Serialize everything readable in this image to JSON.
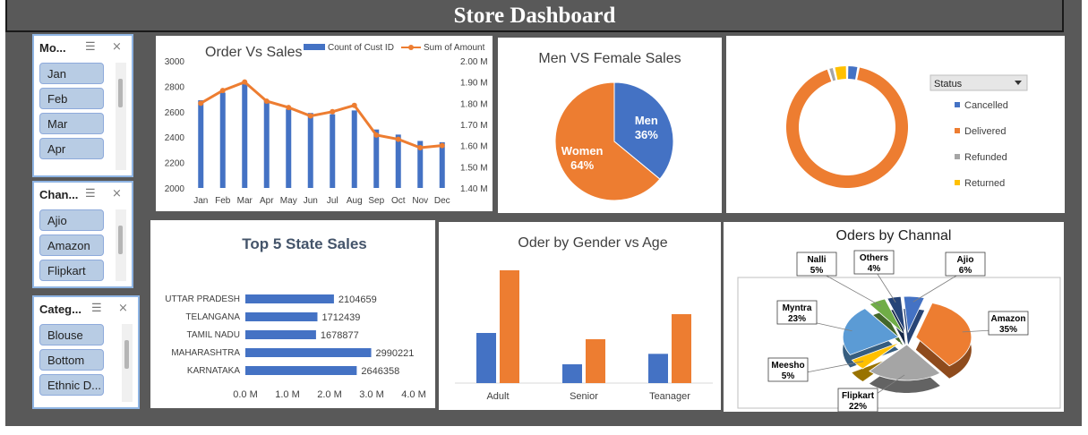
{
  "dashboard": {
    "title": "Store Dashboard"
  },
  "slicers": [
    {
      "header": "Mo...",
      "items": [
        "Jan",
        "Feb",
        "Mar",
        "Apr"
      ]
    },
    {
      "header": "Chan...",
      "items": [
        "Ajio",
        "Amazon",
        "Flipkart"
      ]
    },
    {
      "header": "Categ...",
      "items": [
        "Blouse",
        "Bottom",
        "Ethnic D..."
      ]
    }
  ],
  "slicer_icons": [
    "multi-select-icon",
    "clear-filter-icon"
  ],
  "chart_data": [
    {
      "type": "bar",
      "title": "Order Vs Sales",
      "categories": [
        "Jan",
        "Feb",
        "Mar",
        "Apr",
        "May",
        "Jun",
        "Jul",
        "Aug",
        "Sep",
        "Oct",
        "Nov",
        "Dec"
      ],
      "series": [
        {
          "name": "Count of Cust ID",
          "kind": "bar",
          "axis": "left",
          "color": "#4472c4",
          "values": [
            2690,
            2750,
            2820,
            2690,
            2620,
            2590,
            2580,
            2610,
            2460,
            2420,
            2370,
            2360
          ]
        },
        {
          "name": "Sum of Amount",
          "kind": "line",
          "axis": "right",
          "color": "#ed7d31",
          "values": [
            1.8,
            1.86,
            1.9,
            1.81,
            1.78,
            1.74,
            1.76,
            1.79,
            1.65,
            1.63,
            1.59,
            1.6
          ]
        }
      ],
      "ylim_left": [
        2000,
        3000
      ],
      "yticks_left": [
        "3000",
        "2800",
        "2600",
        "2400",
        "2200",
        "2000"
      ],
      "ylim_right": [
        1.4,
        2.0
      ],
      "yticks_right": [
        "2.00 M",
        "1.90 M",
        "1.80 M",
        "1.70 M",
        "1.60 M",
        "1.50 M",
        "1.40 M"
      ],
      "legend": "top-right"
    },
    {
      "type": "pie",
      "title": "Men VS Female Sales",
      "slices": [
        {
          "label": "Men",
          "value": 36,
          "pct": "36%",
          "color": "#4472c4"
        },
        {
          "label": "Women",
          "value": 64,
          "pct": "64%",
          "color": "#ed7d31"
        }
      ]
    },
    {
      "type": "pie",
      "subtype": "doughnut",
      "legend_title": "Status",
      "slices": [
        {
          "label": "Cancelled",
          "value": 3,
          "color": "#4472c4"
        },
        {
          "label": "Delivered",
          "value": 92,
          "color": "#ed7d31"
        },
        {
          "label": "Refunded",
          "value": 1.5,
          "color": "#a5a5a5"
        },
        {
          "label": "Returned",
          "value": 3.5,
          "color": "#ffc000"
        }
      ],
      "legend": "right"
    },
    {
      "type": "bar",
      "orientation": "horizontal",
      "title": "Top 5 State Sales",
      "categories": [
        "UTTAR PRADESH",
        "TELANGANA",
        "TAMIL NADU",
        "MAHARASHTRA",
        "KARNATAKA"
      ],
      "values": [
        2104659,
        1712439,
        1678877,
        2990221,
        2646358
      ],
      "value_labels": [
        "2104659",
        "1712439",
        "1678877",
        "2990221",
        "2646358"
      ],
      "xlim": [
        0,
        4000000
      ],
      "xticks": [
        "0.0 M",
        "1.0 M",
        "2.0 M",
        "3.0 M",
        "4.0 M"
      ],
      "color": "#4472c4"
    },
    {
      "type": "bar",
      "title": "Oder by Gender vs Age",
      "categories": [
        "Adult",
        "Senior",
        "Teanager"
      ],
      "series": [
        {
          "name": "Men",
          "color": "#4472c4",
          "values": [
            48,
            18,
            28
          ]
        },
        {
          "name": "Women",
          "color": "#ed7d31",
          "values": [
            108,
            42,
            66
          ]
        }
      ],
      "ylim": [
        0,
        120
      ]
    },
    {
      "type": "pie",
      "subtype": "exploded-3d",
      "title": "Oders by Channal",
      "slices": [
        {
          "label": "Ajio",
          "pct": "6%",
          "value": 6,
          "color": "#4472c4"
        },
        {
          "label": "Amazon",
          "pct": "35%",
          "value": 35,
          "color": "#ed7d31"
        },
        {
          "label": "Flipkart",
          "pct": "22%",
          "value": 22,
          "color": "#a5a5a5"
        },
        {
          "label": "Meesho",
          "pct": "5%",
          "value": 5,
          "color": "#ffc000"
        },
        {
          "label": "Myntra",
          "pct": "23%",
          "value": 23,
          "color": "#5b9bd5"
        },
        {
          "label": "Nalli",
          "pct": "5%",
          "value": 5,
          "color": "#70ad47"
        },
        {
          "label": "Others",
          "pct": "4%",
          "value": 4,
          "color": "#264478"
        }
      ]
    }
  ]
}
